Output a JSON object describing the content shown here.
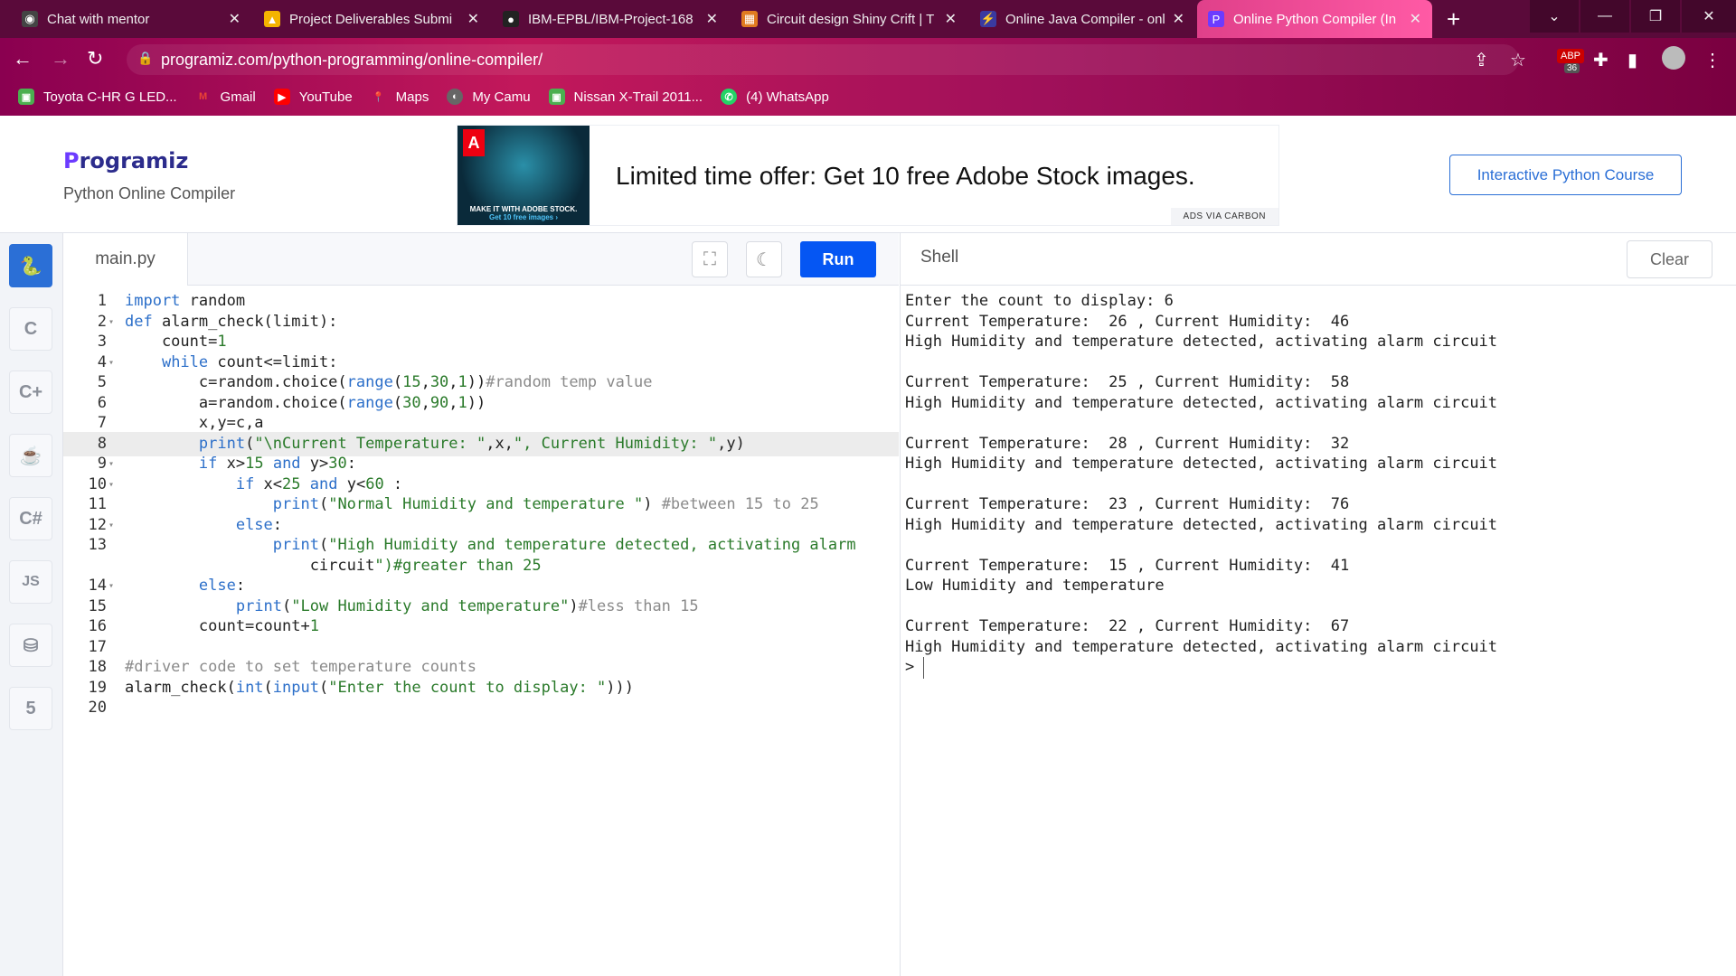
{
  "browser": {
    "tabs": [
      {
        "title": "Chat with mentor",
        "icon": "chat-icon"
      },
      {
        "title": "Project Deliverables Submi",
        "icon": "drive-icon"
      },
      {
        "title": "IBM-EPBL/IBM-Project-168",
        "icon": "github-icon"
      },
      {
        "title": "Circuit design Shiny Crift | T",
        "icon": "tinkercad-icon"
      },
      {
        "title": "Online Java Compiler - onli",
        "icon": "bolt-icon"
      },
      {
        "title": "Online Python Compiler (In",
        "icon": "programiz-icon"
      }
    ],
    "new_tab": "+",
    "url": "programiz.com/python-programming/online-compiler/",
    "extension_badge": "36",
    "bookmarks": [
      {
        "label": "Toyota C-HR G LED...",
        "color": "#4caf50"
      },
      {
        "label": "Gmail",
        "color": "#ea4335"
      },
      {
        "label": "YouTube",
        "color": "#ff0000"
      },
      {
        "label": "Maps",
        "color": "#34a853"
      },
      {
        "label": "My Camu",
        "color": "#888888"
      },
      {
        "label": "Nissan X-Trail 2011...",
        "color": "#4caf50"
      },
      {
        "label": "(4) WhatsApp",
        "color": "#25d366"
      }
    ]
  },
  "header": {
    "logo": "rogramiz",
    "logo_initial": "P",
    "subtitle": "Python Online Compiler",
    "ad_text": "Limited time offer: Get 10 free Adobe Stock images.",
    "ad_caption": "MAKE IT WITH ADOBE STOCK.",
    "ad_caption2": "Get 10 free images ›",
    "ad_via": "ADS VIA CARBON",
    "course_button": "Interactive Python Course"
  },
  "sidebar": {
    "languages": [
      "python",
      "c",
      "cpp",
      "java",
      "csharp",
      "JS",
      "sql",
      "html"
    ]
  },
  "editor": {
    "filename": "main.py",
    "run_label": "Run",
    "highlighted_line": 8
  },
  "code_lines": [
    "import random",
    "def alarm_check(limit):",
    "    count=1",
    "    while count<=limit:",
    "        c=random.choice(range(15,30,1))#random temp value",
    "        a=random.choice(range(30,90,1))",
    "        x,y=c,a",
    "        print(\"\\nCurrent Temperature: \",x,\", Current Humidity: \",y)",
    "        if x>15 and y>30:",
    "            if x<25 and y<60 :",
    "                print(\"Normal Humidity and temperature \") #between 15 to 25",
    "            else:",
    "                print(\"High Humidity and temperature detected, activating alarm",
    "                    circuit\")#greater than 25",
    "        else:",
    "            print(\"Low Humidity and temperature\")#less than 15",
    "        count=count+1",
    "",
    "#driver code to set temperature counts",
    "alarm_check(int(input(\"Enter the count to display: \")))",
    ""
  ],
  "line_numbers": [
    "1",
    "2",
    "3",
    "4",
    "5",
    "6",
    "7",
    "8",
    "9",
    "10",
    "11",
    "12",
    "13",
    "",
    "14",
    "15",
    "16",
    "17",
    "18",
    "19",
    "20"
  ],
  "shell": {
    "title": "Shell",
    "clear_label": "Clear",
    "output": [
      "Enter the count to display: 6",
      "Current Temperature:  26 , Current Humidity:  46",
      "High Humidity and temperature detected, activating alarm circuit",
      "",
      "Current Temperature:  25 , Current Humidity:  58",
      "High Humidity and temperature detected, activating alarm circuit",
      "",
      "Current Temperature:  28 , Current Humidity:  32",
      "High Humidity and temperature detected, activating alarm circuit",
      "",
      "Current Temperature:  23 , Current Humidity:  76",
      "High Humidity and temperature detected, activating alarm circuit",
      "",
      "Current Temperature:  15 , Current Humidity:  41",
      "Low Humidity and temperature",
      "",
      "Current Temperature:  22 , Current Humidity:  67",
      "High Humidity and temperature detected, activating alarm circuit",
      ">"
    ]
  }
}
